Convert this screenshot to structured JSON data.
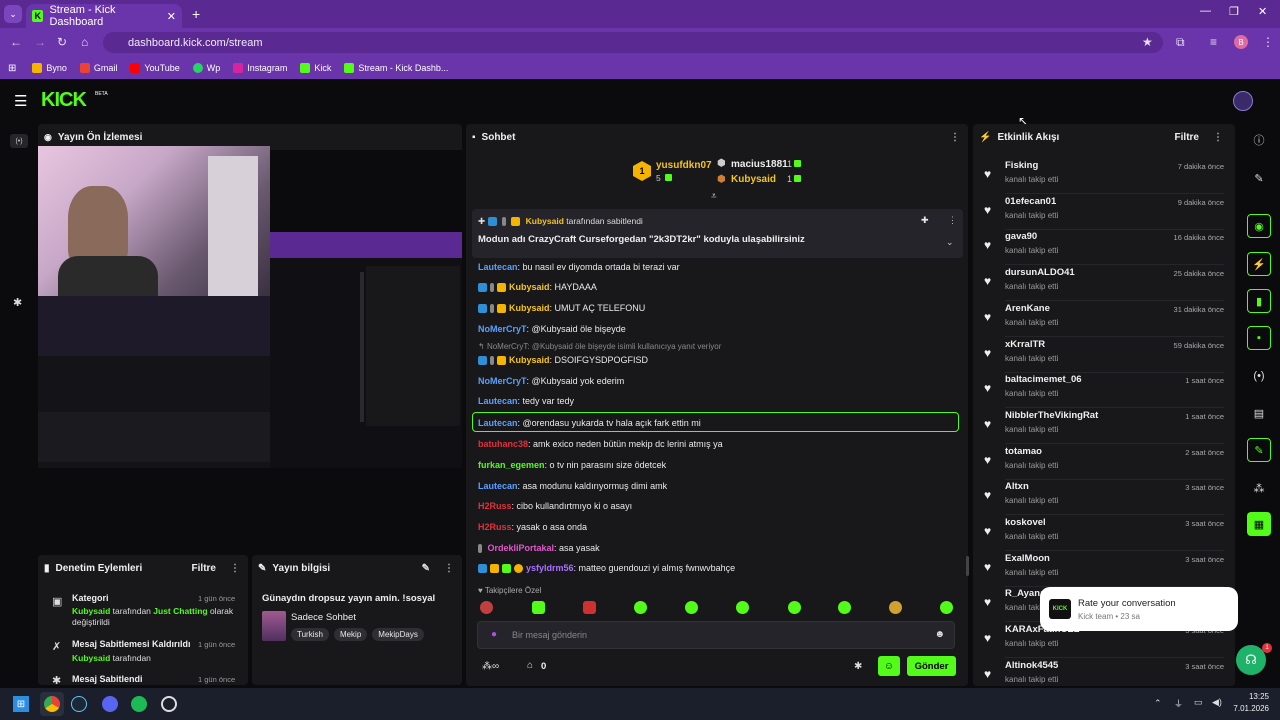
{
  "browser": {
    "tab_title": "Stream - Kick Dashboard",
    "url": "dashboard.kick.com/stream",
    "bookmarks": [
      "Byno",
      "Gmail",
      "YouTube",
      "Wp",
      "Instagram",
      "Kick",
      "Stream - Kick Dashb..."
    ]
  },
  "app": {
    "logo": "KICK",
    "beta": "BETA"
  },
  "preview": {
    "title": "Yayın Ön İzlemesi"
  },
  "moderation": {
    "title": "Denetim Eylemleri",
    "filter": "Filtre",
    "items": [
      {
        "title": "Kategori",
        "time": "1 gün önce",
        "user": "Kubysaid",
        "text1": " tarafından ",
        "highlight": "Just Chatting",
        "text2": " olarak",
        "text3": "değiştirildi"
      },
      {
        "title": "Mesaj Sabitlemesi Kaldırıldı",
        "time": "1 gün önce",
        "user": "Kubysaid",
        "text1": " tarafından"
      },
      {
        "title": "Mesaj Sabitlendi",
        "time": "1 gün önce"
      }
    ]
  },
  "stream_info": {
    "title": "Yayın bilgisi",
    "stream_title": "Günaydın dropsuz yayın amin. !sosyal",
    "category": "Sadece Sohbet",
    "tags": [
      "Turkish",
      "Mekip",
      "MekipDays"
    ]
  },
  "chat": {
    "title": "Sohbet",
    "top_gifters": [
      {
        "name": "yusufdkn07",
        "count": "5"
      },
      {
        "name": "macius1881",
        "count": "1"
      },
      {
        "name": "Kubysaid",
        "count": "1"
      }
    ],
    "pinned_by": "Kubysaid",
    "pinned_label": " tarafından sabitlendi",
    "pinned_message": "Modun adı CrazyCraft Curseforgedan \"2k3DT2kr\" koduyla ulaşabilirsiniz",
    "messages": [
      {
        "user": "Lautecan",
        "color": "#5aa0ff",
        "text": ": bu nasıl ev diyomda ortada bi terazi var"
      },
      {
        "user": "Kubysaid",
        "color": "#f5c518",
        "text": ": HAYDAAA"
      },
      {
        "user": "Kubysaid",
        "color": "#f5c518",
        "text": ": UMUT AÇ TELEFONU"
      },
      {
        "user": "NoMerCryT",
        "color": "#5aa0ff",
        "text": ": @Kubysaid öle bişeyde"
      },
      {
        "user": "NoMerCryT: @Kubysaid öle bişeyde isimli kullanıcıya yanıt veriyor",
        "color": "#8a8a8a",
        "text": ""
      },
      {
        "user": "Kubysaid",
        "color": "#f5c518",
        "text": ": DSOIFGYSDPOGFISD"
      },
      {
        "user": "NoMerCryT",
        "color": "#5aa0ff",
        "text": ": @Kubysaid yok ederim"
      },
      {
        "user": "Lautecan",
        "color": "#5aa0ff",
        "text": ": tedy var tedy"
      },
      {
        "user": "Lautecan",
        "color": "#5aa0ff",
        "text": ": @orendasu yukarda tv hala açık fark ettin mi"
      },
      {
        "user": "batuhanc38",
        "color": "#e0313c",
        "text": ": amk exico neden bütün mekip dc lerini atmış ya"
      },
      {
        "user": "furkan_egemen",
        "color": "#53fc18",
        "text": ": o tv nin parasını size ödetcek"
      },
      {
        "user": "Lautecan",
        "color": "#5aa0ff",
        "text": ": asa modunu kaldırıyormuş dimi amk"
      },
      {
        "user": "H2Russ",
        "color": "#e0313c",
        "text": ": cibo kullandırtmıyo ki o asayı"
      },
      {
        "user": "H2Russ",
        "color": "#e0313c",
        "text": ": yasak o asa onda"
      },
      {
        "user": "OrdekliPortakal",
        "color": "#e058c8",
        "text": ": asa yasak"
      },
      {
        "user": "ysfyldrm56",
        "color": "#a970ff",
        "text": ": matteo guendouzi yi almış fwnwvbahçe"
      }
    ],
    "followers_only": "Takipçilere Özel",
    "input_placeholder": "Bir mesaj gönderin",
    "count": "0",
    "send": "Gönder"
  },
  "activity": {
    "title": "Etkinlik Akışı",
    "filter": "Filtre",
    "sub": "kanalı takip etti",
    "items": [
      {
        "name": "Fisking",
        "time": "7 dakika önce"
      },
      {
        "name": "01efecan01",
        "time": "9 dakika önce"
      },
      {
        "name": "gava90",
        "time": "16 dakika önce"
      },
      {
        "name": "dursunALDO41",
        "time": "25 dakika önce"
      },
      {
        "name": "ArenKane",
        "time": "31 dakika önce"
      },
      {
        "name": "xKrralTR",
        "time": "59 dakika önce"
      },
      {
        "name": "baltacimemet_06",
        "time": "1 saat önce"
      },
      {
        "name": "NibblerTheVikingRat",
        "time": "1 saat önce"
      },
      {
        "name": "totamao",
        "time": "2 saat önce"
      },
      {
        "name": "Altxn",
        "time": "3 saat önce"
      },
      {
        "name": "koskovel",
        "time": "3 saat önce"
      },
      {
        "name": "ExalMoon",
        "time": "3 saat önce"
      },
      {
        "name": "R_Ayana",
        "time": ""
      },
      {
        "name": "KARAxFatihOZL",
        "time": "3 saat önce"
      },
      {
        "name": "Altinok4545",
        "time": "3 saat önce"
      }
    ]
  },
  "toast": {
    "title": "Rate your conversation",
    "sub": "Kick team • 23 sa"
  },
  "taskbar": {
    "time": "13:25",
    "date": "7.01.2026"
  },
  "colors": {
    "kick_green": "#53fc18",
    "browser_purple": "#6a34aa"
  }
}
